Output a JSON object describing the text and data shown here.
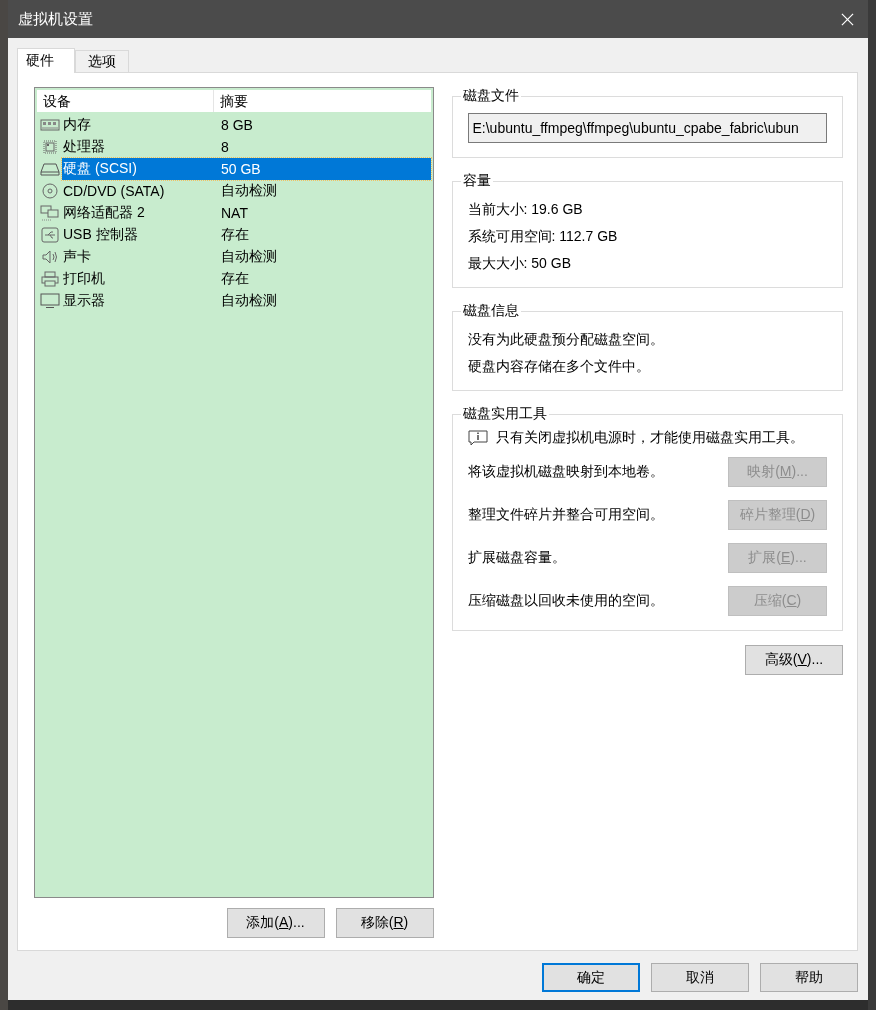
{
  "window": {
    "title": "虚拟机设置"
  },
  "tabs": [
    {
      "label": "硬件",
      "selected": true
    },
    {
      "label": "选项",
      "selected": false
    }
  ],
  "device_list": {
    "columns": [
      "设备",
      "摘要"
    ],
    "rows": [
      {
        "kind": "memory",
        "device": "内存",
        "summary": "8 GB",
        "selected": false
      },
      {
        "kind": "cpu",
        "device": "处理器",
        "summary": "8",
        "selected": false
      },
      {
        "kind": "disk",
        "device": "硬盘 (SCSI)",
        "summary": "50 GB",
        "selected": true
      },
      {
        "kind": "cdrom",
        "device": "CD/DVD (SATA)",
        "summary": "自动检测",
        "selected": false
      },
      {
        "kind": "network",
        "device": "网络适配器 2",
        "summary": "NAT",
        "selected": false
      },
      {
        "kind": "usb",
        "device": "USB 控制器",
        "summary": "存在",
        "selected": false
      },
      {
        "kind": "sound",
        "device": "声卡",
        "summary": "自动检测",
        "selected": false
      },
      {
        "kind": "printer",
        "device": "打印机",
        "summary": "存在",
        "selected": false
      },
      {
        "kind": "display",
        "device": "显示器",
        "summary": "自动检测",
        "selected": false
      }
    ],
    "buttons": [
      {
        "before": "添加(",
        "key": "A",
        "after": ")..."
      },
      {
        "before": "移除(",
        "key": "R",
        "after": ")"
      }
    ]
  },
  "disk_file": {
    "title": "磁盘文件",
    "value": "E:\\ubuntu_ffmpeg\\ffmpeg\\ubuntu_cpabe_fabric\\ubun"
  },
  "capacity": {
    "title": "容量",
    "lines": [
      "当前大小: 19.6 GB",
      "系统可用空间: 112.7 GB",
      "最大大小: 50 GB"
    ]
  },
  "disk_info": {
    "title": "磁盘信息",
    "lines": [
      "没有为此硬盘预分配磁盘空间。",
      "硬盘内容存储在多个文件中。"
    ]
  },
  "utilities": {
    "title": "磁盘实用工具",
    "notice": "只有关闭虚拟机电源时，才能使用磁盘实用工具。",
    "actions": [
      {
        "description": "将该虚拟机磁盘映射到本地卷。",
        "button": {
          "before": "映射(",
          "key": "M",
          "after": ")..."
        },
        "disabled": true
      },
      {
        "description": "整理文件碎片并整合可用空间。",
        "button": {
          "before": "碎片整理(",
          "key": "D",
          "after": ")"
        },
        "disabled": true
      },
      {
        "description": "扩展磁盘容量。",
        "button": {
          "before": "扩展(",
          "key": "E",
          "after": ")..."
        },
        "disabled": true
      },
      {
        "description": "压缩磁盘以回收未使用的空间。",
        "button": {
          "before": "压缩(",
          "key": "C",
          "after": ")"
        },
        "disabled": true
      }
    ]
  },
  "advanced_button": {
    "before": "高级(",
    "key": "V",
    "after": ")..."
  },
  "footer_buttons": [
    {
      "label": "确定",
      "default": true
    },
    {
      "label": "取消",
      "default": false
    },
    {
      "label": "帮助",
      "default": false
    }
  ]
}
